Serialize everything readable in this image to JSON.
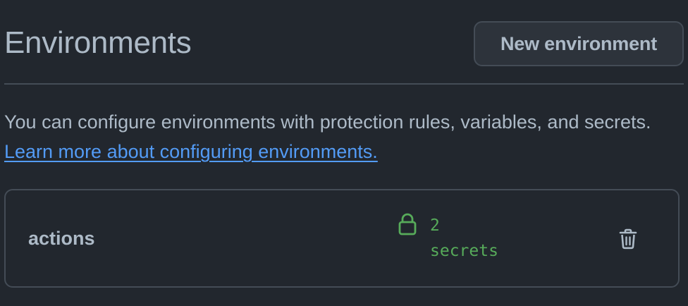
{
  "header": {
    "title": "Environments",
    "new_button_label": "New environment"
  },
  "description": {
    "text": "You can configure environments with protection rules, variables, and secrets. ",
    "link_text": "Learn more about configuring environments."
  },
  "environments": [
    {
      "name": "actions",
      "secrets_label": "2 secrets",
      "lock_icon": "lock-icon",
      "delete_icon": "trash-icon"
    }
  ],
  "colors": {
    "background": "#22272e",
    "border": "#444c56",
    "text": "#adbac7",
    "link": "#539bf5",
    "secrets": "#57ab5a",
    "button_bg": "#2d333b"
  }
}
